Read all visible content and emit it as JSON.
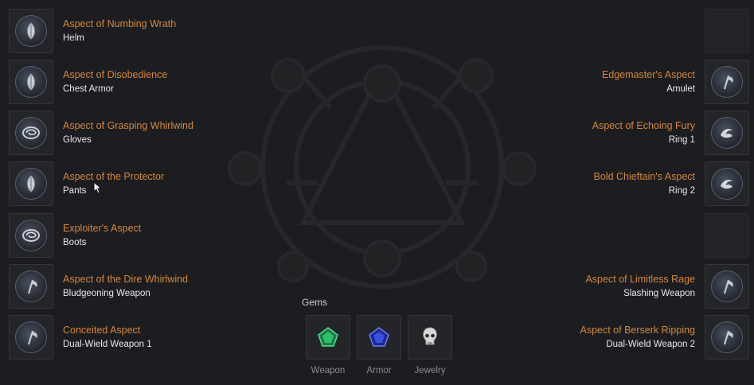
{
  "left_slots": [
    {
      "aspect": "Aspect of Numbing Wrath",
      "slot": "Helm",
      "icon": "armor-feather-icon"
    },
    {
      "aspect": "Aspect of Disobedience",
      "slot": "Chest Armor",
      "icon": "armor-feather-icon"
    },
    {
      "aspect": "Aspect of Grasping Whirlwind",
      "slot": "Gloves",
      "icon": "swirl-icon"
    },
    {
      "aspect": "Aspect of the Protector",
      "slot": "Pants",
      "icon": "armor-feather-icon"
    },
    {
      "aspect": "Exploiter's Aspect",
      "slot": "Boots",
      "icon": "swirl-icon"
    },
    {
      "aspect": "Aspect of the Dire Whirlwind",
      "slot": "Bludgeoning Weapon",
      "icon": "axe-icon"
    },
    {
      "aspect": "Conceited Aspect",
      "slot": "Dual-Wield Weapon 1",
      "icon": "axe-icon"
    }
  ],
  "right_slots": [
    {
      "aspect": "",
      "slot": "",
      "icon": "empty"
    },
    {
      "aspect": "Edgemaster's Aspect",
      "slot": "Amulet",
      "icon": "axe-icon"
    },
    {
      "aspect": "Aspect of Echoing Fury",
      "slot": "Ring 1",
      "icon": "wave-icon"
    },
    {
      "aspect": "Bold Chieftain's Aspect",
      "slot": "Ring 2",
      "icon": "wave-icon"
    },
    {
      "aspect": "",
      "slot": "",
      "icon": "empty"
    },
    {
      "aspect": "Aspect of Limitless Rage",
      "slot": "Slashing Weapon",
      "icon": "axe-icon"
    },
    {
      "aspect": "Aspect of Berserk Ripping",
      "slot": "Dual-Wield Weapon 2",
      "icon": "axe-icon"
    }
  ],
  "gems": {
    "title": "Gems",
    "items": [
      {
        "label": "Weapon",
        "icon": "emerald-gem-icon",
        "color": "#2fbf6a"
      },
      {
        "label": "Armor",
        "icon": "sapphire-gem-icon",
        "color": "#3a4fe0"
      },
      {
        "label": "Jewelry",
        "icon": "skull-gem-icon",
        "color": "#d8d8d8"
      }
    ]
  },
  "colors": {
    "aspect_text": "#d5863a",
    "slot_text": "#e8e8e8",
    "background": "#1c1d20"
  }
}
